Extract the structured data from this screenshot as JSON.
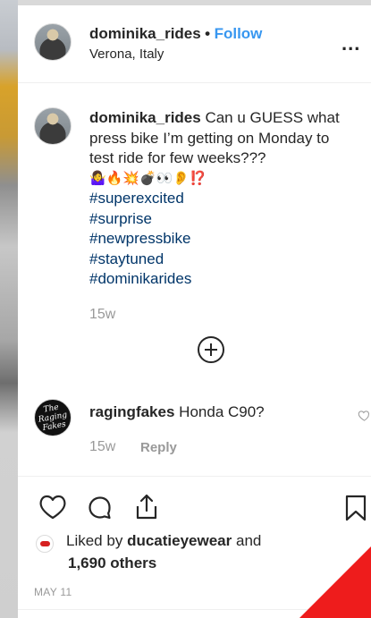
{
  "post": {
    "username": "dominika_rides",
    "separator": "•",
    "follow_label": "Follow",
    "location": "Verona, Italy",
    "more_label": "..."
  },
  "caption": {
    "username": "dominika_rides",
    "text": "Can u GUESS what press bike I’m getting on Monday to test ride for few weeks???",
    "emojis": "🤷‍♀️🔥💥💣👀👂⁉️",
    "hashtags": [
      "#superexcited",
      "#surprise",
      "#newpressbike",
      "#staytuned",
      "#dominikarides"
    ],
    "age": "15w"
  },
  "load_more": {
    "icon": "plus-circle-icon"
  },
  "comment": {
    "username": "ragingfakes",
    "text": "Honda C90?",
    "age": "15w",
    "reply_label": "Reply",
    "avatar_text": "The Raging Fakes"
  },
  "actions": {
    "like_icon": "heart-icon",
    "comment_icon": "comment-icon",
    "share_icon": "share-icon",
    "save_icon": "bookmark-icon"
  },
  "likes": {
    "prefix": "Liked by",
    "user": "ducatieyewear",
    "connector": "and",
    "others": "1,690 others"
  },
  "date": "MAY 11",
  "colors": {
    "link": "#3897f0",
    "hashtag": "#003569",
    "muted": "#999999",
    "text": "#262626",
    "accent_red": "#ee1c1c"
  }
}
